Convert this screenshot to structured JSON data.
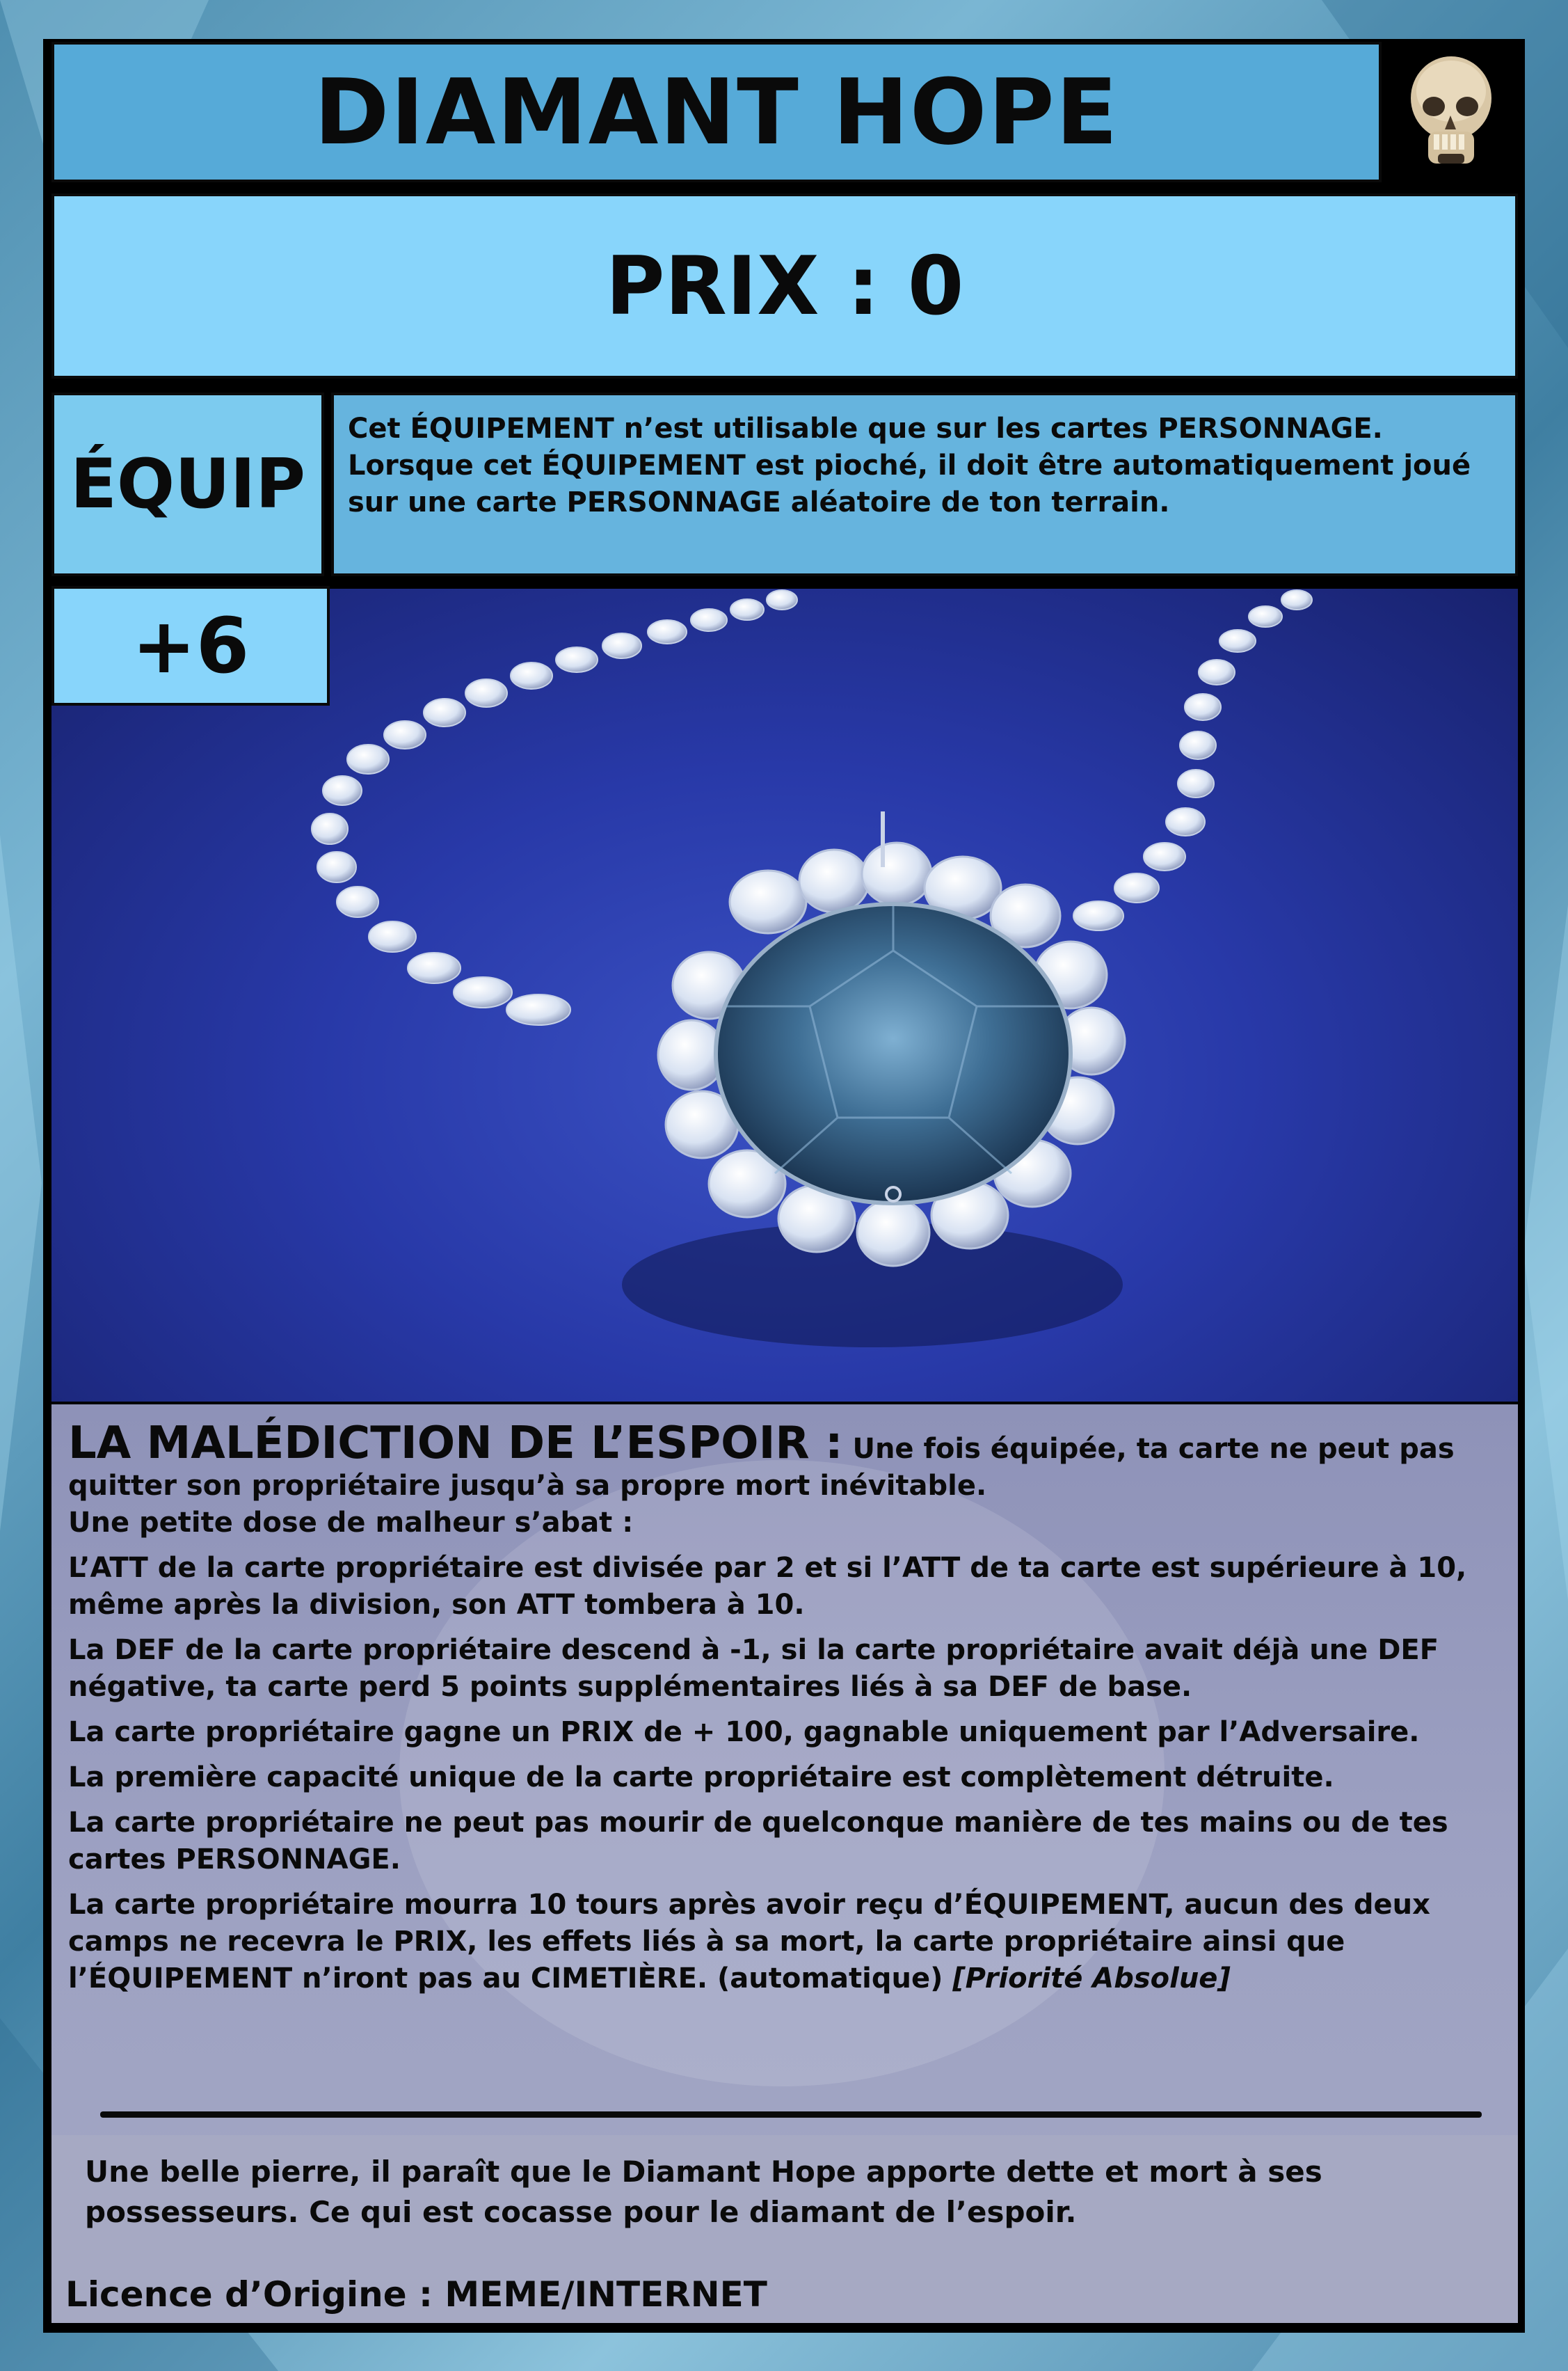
{
  "card": {
    "title": "DIAMANT HOPE",
    "price_label": "PRIX : 0",
    "type": "ÉQUIP",
    "bonus": "+6",
    "rule_text": "Cet ÉQUIPEMENT n’est utilisable que sur les cartes PERSONNAGE. Lorsque cet ÉQUIPEMENT est pioché, il doit être automatiquement joué sur une carte PERSONNAGE aléatoire de ton terrain.",
    "corner_icon": "skull-icon",
    "effect": {
      "heading": "LA MALÉDICTION DE L’ESPOIR :",
      "intro": "Une fois équipée, ta carte ne peut pas quitter son propriétaire jusqu’à sa propre mort inévitable.",
      "intro2": "Une petite dose de malheur s’abat :",
      "lines": [
        "L’ATT de la carte propriétaire est divisée par 2 et si l’ATT de ta carte est supérieure à 10, même après la division, son ATT tombera à 10.",
        "La DEF de la carte propriétaire descend à -1, si la carte propriétaire avait déjà une DEF négative, ta carte perd 5 points supplémentaires liés à sa DEF de base.",
        "La carte propriétaire gagne un PRIX de + 100, gagnable uniquement par l’Adversaire.",
        "La première capacité unique de la carte propriétaire est complètement détruite.",
        "La carte propriétaire ne peut pas mourir de quelconque manière de tes mains ou de tes cartes PERSONNAGE."
      ],
      "last_line": "La carte propriétaire mourra 10 tours après avoir reçu d’ÉQUIPEMENT, aucun des deux camps ne recevra le PRIX, les effets liés à sa mort, la carte propriétaire ainsi que l’ÉQUIPEMENT n’iront pas au CIMETIÈRE. (automatique)",
      "priority": "[Priorité Absolue]"
    },
    "flavor": "Une belle pierre, il paraît que le Diamant Hope apporte dette et mort à ses possesseurs. Ce qui est cocasse pour le diamant de l’espoir.",
    "licence": "Licence d’Origine : MEME/INTERNET",
    "colors": {
      "title_bg": "#56aad8",
      "price_bg": "#88d5fb",
      "rule_bg": "#66b4de",
      "image_bg": "#2839a8",
      "gem": "#3f6f95",
      "effect_bg": "#9da1c2"
    }
  }
}
